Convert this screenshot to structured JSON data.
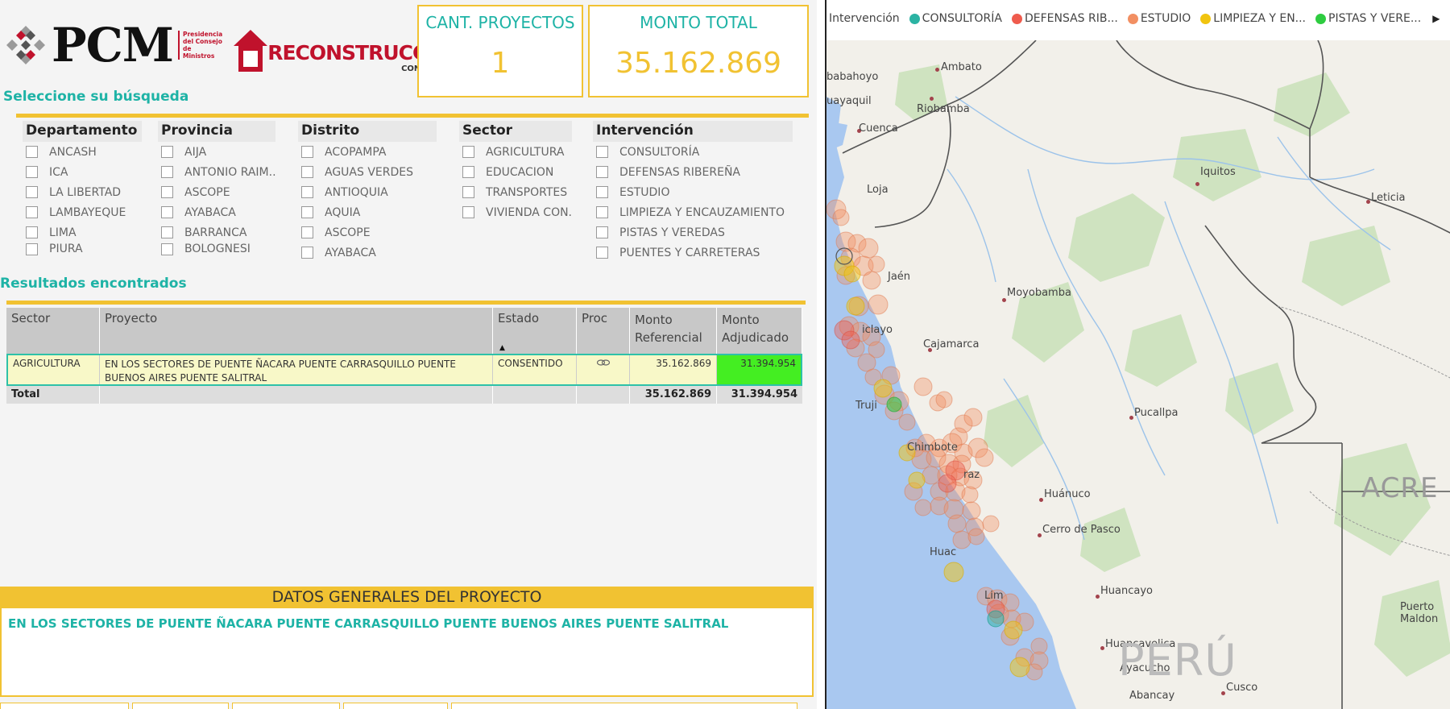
{
  "header": {
    "pcm_logo": "PCM",
    "pcm_subtitle": "Presidencia del Consejo de Ministros",
    "recon_logo": "RECONSTRUCCIÓN",
    "recon_subtitle": "CON CAMBIOS"
  },
  "kpis": {
    "projects_label": "CANT. PROYECTOS",
    "projects_value": "1",
    "total_label": "MONTO TOTAL",
    "total_value": "35.162.869"
  },
  "search": {
    "title": "Seleccione su búsqueda",
    "filters": [
      {
        "label": "Departamento",
        "items": [
          "ANCASH",
          "ICA",
          "LA LIBERTAD",
          "LAMBAYEQUE",
          "LIMA",
          "PIURA"
        ]
      },
      {
        "label": "Provincia",
        "items": [
          "AIJA",
          "ANTONIO RAIM...",
          "ASCOPE",
          "AYABACA",
          "BARRANCA",
          "BOLOGNESI"
        ]
      },
      {
        "label": "Distrito",
        "items": [
          "ACOPAMPA",
          "AGUAS VERDES",
          "ANTIOQUIA",
          "AQUIA",
          "ASCOPE",
          "AYABACA"
        ]
      },
      {
        "label": "Sector",
        "items": [
          "AGRICULTURA",
          "EDUCACION",
          "TRANSPORTES ...",
          "VIVIENDA CON..."
        ]
      },
      {
        "label": "Intervención",
        "items": [
          "CONSULTORÍA",
          "DEFENSAS RIBEREÑA",
          "ESTUDIO",
          "LIMPIEZA Y ENCAUZAMIENTO",
          "PISTAS Y VEREDAS",
          "PUENTES Y CARRETERAS"
        ]
      }
    ]
  },
  "results": {
    "title": "Resultados encontrados",
    "columns": {
      "sector": "Sector",
      "proyecto": "Proyecto",
      "estado": "Estado",
      "proc": "Proc",
      "monto_ref_1": "Monto",
      "monto_ref_2": "Referencial",
      "monto_adj_1": "Monto",
      "monto_adj_2": "Adjudicado"
    },
    "sort_indicator": "▲",
    "row": {
      "sector": "AGRICULTURA",
      "proyecto": "EN LOS SECTORES DE PUENTE ÑACARA PUENTE CARRASQUILLO PUENTE BUENOS AIRES PUENTE SALITRAL",
      "estado": "CONSENTIDO",
      "monto_ref": "35.162.869",
      "monto_adj": "31.394.954"
    },
    "total": {
      "label": "Total",
      "monto_ref": "35.162.869",
      "monto_adj": "31.394.954"
    }
  },
  "datos": {
    "title": "DATOS GENERALES DEL PROYECTO",
    "text": "EN LOS SECTORES DE PUENTE ÑACARA PUENTE CARRASQUILLO PUENTE BUENOS AIRES PUENTE SALITRAL"
  },
  "map": {
    "legend_title": "Intervención",
    "legend": [
      {
        "label": "CONSULTORÍA",
        "color": "#2bb3a3"
      },
      {
        "label": "DEFENSAS RIB...",
        "color": "#ef5b4d"
      },
      {
        "label": "ESTUDIO",
        "color": "#f28f62"
      },
      {
        "label": "LIMPIEZA Y EN...",
        "color": "#f1c40f"
      },
      {
        "label": "PISTAS Y VERE...",
        "color": "#2ecc40"
      }
    ],
    "more_arrow": "▶",
    "cities": {
      "ambato": "Ambato",
      "babahoyo": "babahoyo",
      "riobamba": "Riobamba",
      "guayaquil": "uayaquil",
      "cuenca": "Cuenca",
      "loja": "Loja",
      "iquitos": "Iquitos",
      "leticia": "Leticia",
      "jaen": "Jaén",
      "moyobamba": "Moyobamba",
      "chiclayo": "iclayo",
      "cajamarca": "Cajamarca",
      "trujillo": "Truji",
      "pucallpa": "Pucallpa",
      "chimbote": "Chimbote",
      "huaraz": "raz",
      "huanuco": "Huánuco",
      "cerro_de_pasco": "Cerro de Pasco",
      "huacho": "Huac",
      "lima": "Lim",
      "huancayo": "Huancayo",
      "huancavelica": "Huancavelica",
      "ayacucho": "Ayacucho",
      "abancay": "Abancay",
      "cusco": "Cusco",
      "puerto_maldonado": "Puerto Maldon"
    },
    "regions": {
      "acre": "ACRE",
      "peru": "PERÚ"
    }
  }
}
